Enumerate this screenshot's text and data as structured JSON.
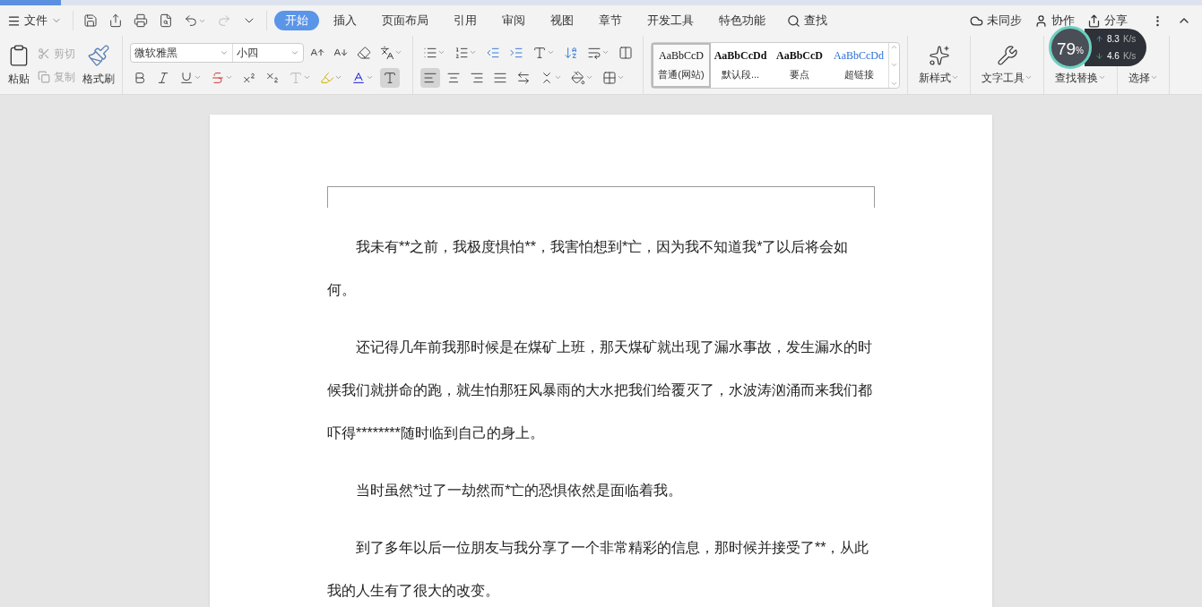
{
  "menu": {
    "file_label": "文件",
    "tabs": [
      {
        "label": "开始",
        "selected": true
      },
      {
        "label": "插入",
        "selected": false
      },
      {
        "label": "页面布局",
        "selected": false
      },
      {
        "label": "引用",
        "selected": false
      },
      {
        "label": "审阅",
        "selected": false
      },
      {
        "label": "视图",
        "selected": false
      },
      {
        "label": "章节",
        "selected": false
      },
      {
        "label": "开发工具",
        "selected": false
      },
      {
        "label": "特色功能",
        "selected": false
      }
    ],
    "search": "查找",
    "sync": "未同步",
    "collab": "协作",
    "share": "分享"
  },
  "clipboard": {
    "paste": "粘贴",
    "cut": {
      "label": "剪切",
      "disabled": true
    },
    "copy": {
      "label": "复制",
      "disabled": true
    },
    "painter": "格式刷"
  },
  "font": {
    "name": "微软雅黑",
    "size": "小四"
  },
  "align": [
    {
      "selected": true
    },
    {
      "selected": false
    },
    {
      "selected": false
    },
    {
      "selected": false
    },
    {
      "selected": false
    }
  ],
  "styles": [
    {
      "preview": "AaBbCcD",
      "label": "普通(网站)",
      "kind": "plain",
      "selected": true
    },
    {
      "preview": "AaBbCcDd",
      "label": "默认段...",
      "kind": "semibold",
      "selected": false
    },
    {
      "preview": "AaBbCcD",
      "label": "要点",
      "kind": "bold",
      "selected": false
    },
    {
      "preview": "AaBbCcDd",
      "label": "超链接",
      "kind": "link",
      "selected": false
    }
  ],
  "tools": [
    "新样式",
    "文字工具",
    "查找替换",
    "选择"
  ],
  "speed_widget": {
    "percent": "79",
    "percent_sign": "%",
    "up": "8.3",
    "up_unit": "K/s",
    "down": "4.6",
    "down_unit": "K/s"
  },
  "document": {
    "paragraphs": [
      "我未有**之前，我极度惧怕**，我害怕想到*亡，因为我不知道我*了以后将会如何。",
      "还记得几年前我那时候是在煤矿上班，那天煤矿就出现了漏水事故，发生漏水的时候我们就拼命的跑，就生怕那狂风暴雨的大水把我们给覆灭了，水波涛汹涌而来我们都吓得********随时临到自己的身上。",
      "当时虽然*过了一劫然而*亡的恐惧依然是面临着我。",
      "到了多年以后一位朋友与我分享了一个非常精彩的信息，那时候并接受了**，从此我的人生有了很大的改变。"
    ]
  }
}
